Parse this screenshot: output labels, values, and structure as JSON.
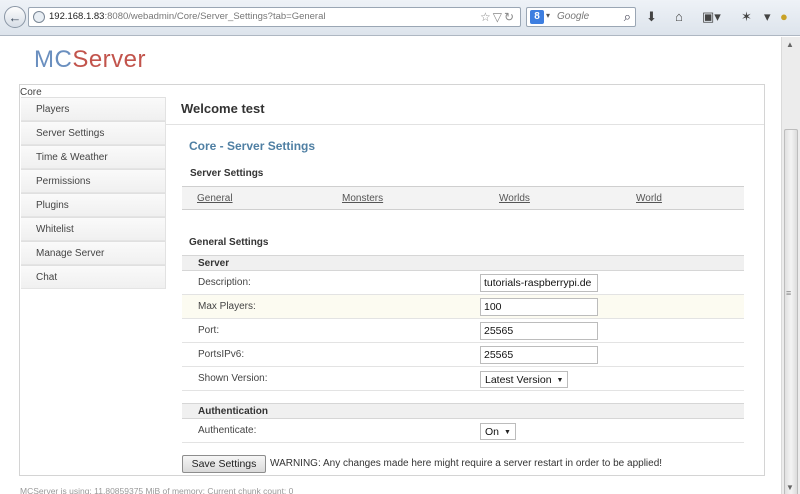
{
  "browser": {
    "url_host": "192.168.1.83",
    "url_rest": ":8080/webadmin/Core/Server_Settings?tab=General",
    "search_engine_badge": "8",
    "search_placeholder": "Google"
  },
  "logo": {
    "part1": "MC",
    "part2": "Server"
  },
  "sidebar": {
    "title": "Core",
    "items": [
      {
        "label": "Players"
      },
      {
        "label": "Server Settings"
      },
      {
        "label": "Time & Weather"
      },
      {
        "label": "Permissions"
      },
      {
        "label": "Plugins"
      },
      {
        "label": "Whitelist"
      },
      {
        "label": "Manage Server"
      },
      {
        "label": "Chat"
      }
    ]
  },
  "main": {
    "welcome": "Welcome test",
    "section_title": "Core - Server Settings",
    "sub_title": "Server Settings",
    "tabs": [
      {
        "label": "General"
      },
      {
        "label": "Monsters"
      },
      {
        "label": "Worlds"
      },
      {
        "label": "World"
      }
    ],
    "general_settings_title": "General Settings",
    "server_group": {
      "title": "Server",
      "description_label": "Description:",
      "description_value": "tutorials-raspberrypi.de",
      "max_players_label": "Max Players:",
      "max_players_value": "100",
      "port_label": "Port:",
      "port_value": "25565",
      "portsipv6_label": "PortsIPv6:",
      "portsipv6_value": "25565",
      "shown_version_label": "Shown Version:",
      "shown_version_value": "Latest Version"
    },
    "auth_group": {
      "title": "Authentication",
      "authenticate_label": "Authenticate:",
      "authenticate_value": "On"
    },
    "save_button": "Save Settings",
    "warning": "WARNING: Any changes made here might require a server restart in order to be applied!"
  },
  "footer": "MCServer is using: 11.80859375 MiB of memory; Current chunk count: 0",
  "colors": {
    "logo_mc": "#6a8fbf",
    "logo_server": "#c2544c",
    "section_title": "#4f7fa3",
    "highlight_row": "#fcfbf1"
  }
}
